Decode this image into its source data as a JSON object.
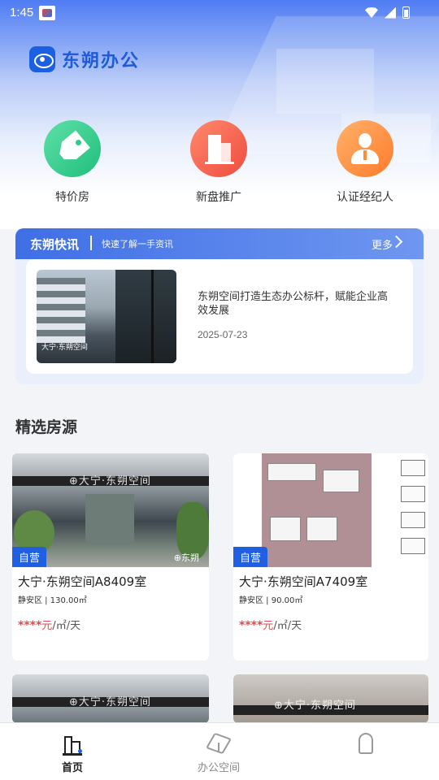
{
  "status_bar": {
    "time": "1:45"
  },
  "app": {
    "brand_name": "东朔办公"
  },
  "quick_entries": [
    {
      "label": "特价房",
      "icon": "tag-icon",
      "color": "#23c581"
    },
    {
      "label": "新盘推广",
      "icon": "building-icon",
      "color": "#f0553f"
    },
    {
      "label": "认证经纪人",
      "icon": "agent-icon",
      "color": "#ff8a30"
    }
  ],
  "news": {
    "title": "东朔快讯",
    "subtitle": "快速了解一手资讯",
    "more": "更多",
    "item": {
      "headline": "东朔空间打造生态办公标杆，赋能企业高效发展",
      "date": "2025-07-23",
      "image_caption": "大宁·东朔空间"
    }
  },
  "section": {
    "title": "精选房源"
  },
  "listings": [
    {
      "badge": "自营",
      "title": "大宁·东朔空间A8409室",
      "district": "静安区",
      "area": "130.00㎡",
      "price_masked": "****",
      "price_unit": "元",
      "price_suffix": "/㎡/天",
      "image_sign": "⊕大宁·东朔空间",
      "image_watermark": "⊕东朔"
    },
    {
      "badge": "自营",
      "title": "大宁·东朔空间A7409室",
      "district": "静安区",
      "area": "90.00㎡",
      "price_masked": "****",
      "price_unit": "元",
      "price_suffix": "/㎡/天"
    },
    {
      "image_sign": "⊕大宁·东朔空间"
    },
    {
      "image_sign": "⊕大宁·东朔空间"
    }
  ],
  "tabbar": [
    {
      "label": "首页",
      "active": true
    },
    {
      "label": "办公空间",
      "active": false
    },
    {
      "label": "",
      "active": false
    }
  ],
  "colors": {
    "primary": "#1f5fe0",
    "price": "#e5484d"
  }
}
